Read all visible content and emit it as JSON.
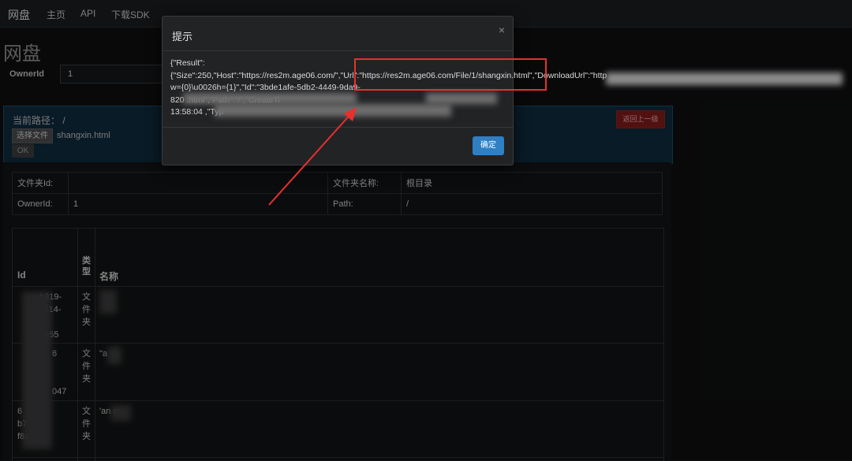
{
  "navbar": {
    "brand": "网盘",
    "links": [
      "主页",
      "API",
      "下载SDK"
    ]
  },
  "page": {
    "title": "网盘",
    "owner_label": "OwnerId",
    "owner_value": "1"
  },
  "upload_panel": {
    "path_label": "当前路径： /",
    "choose_file_label": "选择文件",
    "file_name": "shangxin.html",
    "ok_label": "OK",
    "back_label": "返回上一级"
  },
  "folder_info": {
    "folder_id_label": "文件夹Id:",
    "folder_id_value": "",
    "folder_name_label": "文件夹名称:",
    "folder_name_value": "根目录",
    "owner_label": "OwnerId:",
    "owner_value": "1",
    "path_label": "Path:",
    "path_value": "/"
  },
  "file_list": {
    "headers": {
      "id": "Id",
      "type": "类型",
      "name": "名称"
    },
    "rows": [
      {
        "id_visible": "b319-\nc214-\n9\n1e55",
        "type": "文件夹",
        "name": ""
      },
      {
        "id_visible": "6\n\n\n047",
        "type": "文件夹",
        "name": "\"a"
      },
      {
        "id_visible": "6\nb7\nf8afbd1",
        "type": "文件夹",
        "name": "'an m"
      }
    ]
  },
  "modal": {
    "title": "提示",
    "close_glyph": "×",
    "body_text": "{\"Result\":\n{\"Size\":250,\"Host\":\"https://res2m.age06.com/\",\"Url\":\"https://res2m.age06.com/File/1/shangxin.html\",\"DownloadUrl\":\"http\nw={0}\\u0026h={1}\",\"Id\":\"3bde1afe-5db2-4449-9da9-\n820 .html\",\"Path\":\"/\",\"CreateTi\n13:58:04 ,\"Typ",
    "confirm_label": "确定"
  },
  "colors": {
    "accent_blue": "#2f7fc5",
    "danger_red": "#7d1b1b",
    "annotation_red": "#e8302e",
    "panel_blue": "#0f2a3c"
  }
}
